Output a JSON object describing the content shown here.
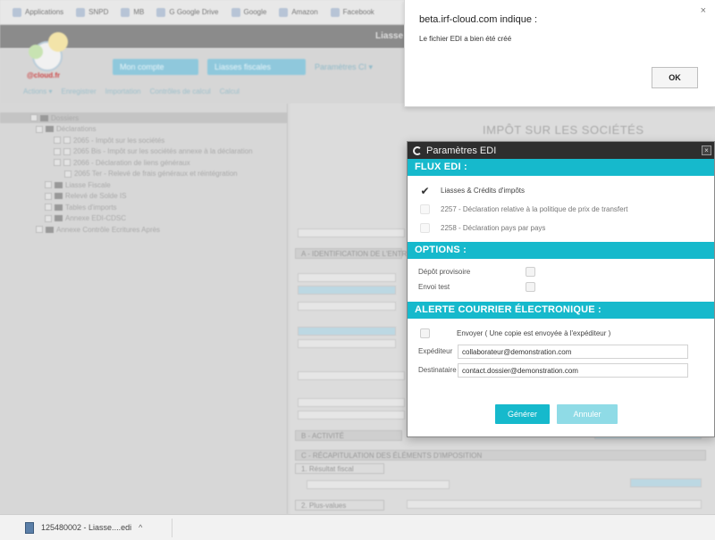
{
  "browser": {
    "bookmarks": [
      "Applications",
      "SNPD",
      "MB",
      "G Google Drive",
      "Google",
      "Amazon",
      "Facebook"
    ],
    "download": {
      "filename": "125480002 - Liasse....edi",
      "caret": "^"
    }
  },
  "app": {
    "title": "Liasse",
    "logo_text": "@cloud.fr",
    "nav_buttons": [
      "Mon compte",
      "Liasses fiscales"
    ],
    "nav_tab": "Paramètres CI ▾",
    "subnav": [
      "Actions ▾",
      "Enregistrer",
      "Importation",
      "Contrôles de calcul",
      "Calcul"
    ],
    "tree": [
      "Dossiers",
      "Déclarations",
      "2065 - Impôt sur les sociétés",
      "2065 Bis - Impôt sur les sociétés annexe à la déclaration",
      "2066 - Déclaration de liens généraux",
      "2065 Ter - Relevé de frais généraux et réintégration",
      "Liasse Fiscale",
      "Relevé de Solde IS",
      "Tables d'imports",
      "Annexe EDI-CDSC",
      "Annexe Contrôle Ecritures Après"
    ],
    "doc_title": "IMPÔT SUR LES SOCIÉTÉS",
    "doc_sections": [
      "A - IDENTIFICATION DE L'ENTREPRISE",
      "B - ACTIVITÉ",
      "C - RÉCAPITULATION DES ÉLÉMENTS D'IMPOSITION",
      "1. Résultat fiscal",
      "2. Plus-values"
    ]
  },
  "alert": {
    "header": "beta.irf-cloud.com indique :",
    "message": "Le fichier EDI a bien été créé",
    "ok_label": "OK",
    "close": "×"
  },
  "edi_dialog": {
    "title": "Paramètres EDI",
    "close": "×",
    "flux_header": "FLUX EDI :",
    "flux_items": [
      {
        "label": "Liasses & Crédits d'impôts",
        "checked": true
      },
      {
        "label": "2257 - Déclaration relative à la politique de prix de transfert",
        "checked": false
      },
      {
        "label": "2258 - Déclaration pays par pays",
        "checked": false
      }
    ],
    "options_header": "OPTIONS :",
    "options": [
      {
        "label": "Dépôt provisoire",
        "checked": false
      },
      {
        "label": "Envoi test",
        "checked": false
      }
    ],
    "alert_header": "ALERTE COURRIER ÉLECTRONIQUE :",
    "copy_label": "Envoyer ( Une copie est envoyée à l'expéditeur )",
    "sender_label": "Expéditeur",
    "sender_value": "collaborateur@demonstration.com",
    "recipient_label": "Destinataire",
    "recipient_value": "contact.dossier@demonstration.com",
    "generate_label": "Générer",
    "cancel_label": "Annuler"
  }
}
